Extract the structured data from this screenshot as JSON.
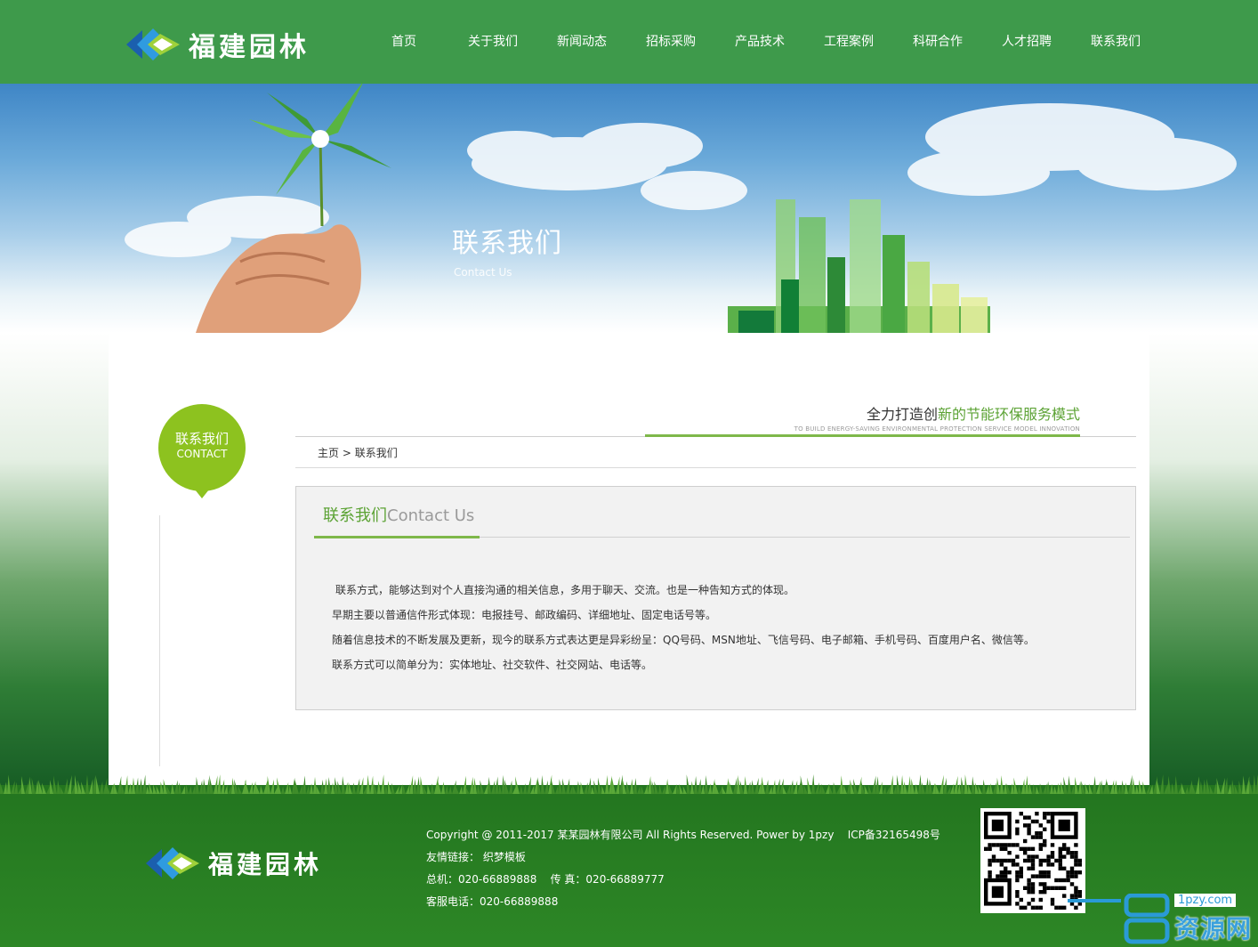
{
  "brand": {
    "name": "福建园林",
    "colors": {
      "header": "#3e9a4b",
      "accent": "#8dc21f",
      "green_text": "#5ca335",
      "footer": "#2d8726"
    }
  },
  "nav": {
    "items": [
      {
        "label": "首页"
      },
      {
        "label": "关于我们"
      },
      {
        "label": "新闻动态"
      },
      {
        "label": "招标采购"
      },
      {
        "label": "产品技术"
      },
      {
        "label": "工程案例"
      },
      {
        "label": "科研合作"
      },
      {
        "label": "人才招聘"
      },
      {
        "label": "联系我们"
      }
    ]
  },
  "banner": {
    "title": "联系我们",
    "subtitle": "Contact Us"
  },
  "sidebar": {
    "title_cn": "联系我们",
    "title_en": "CONTACT"
  },
  "slogan": {
    "prefix": "全力打造创",
    "highlight": "新的节能环保服务模式",
    "english": "TO BUILD ENERGY-SAVING ENVIRONMENTAL PROTECTION SERVICE MODEL INNOVATION"
  },
  "breadcrumb": {
    "home": "主页",
    "separator": ">",
    "current": "联系我们"
  },
  "panel": {
    "title_cn": "联系我们",
    "title_en": "Contact Us",
    "paragraphs": [
      "联系方式，能够达到对个人直接沟通的相关信息，多用于聊天、交流。也是一种告知方式的体现。",
      "早期主要以普通信件形式体现：电报挂号、邮政编码、详细地址、固定电话号等。",
      "随着信息技术的不断发展及更新，现今的联系方式表达更是异彩纷呈：QQ号码、MSN地址、飞信号码、电子邮箱、手机号码、百度用户名、微信等。",
      "联系方式可以简单分为：实体地址、社交软件、社交网站、电话等。"
    ]
  },
  "footer": {
    "copyright": "Copyright @ 2011-2017 某某园林有限公司 All Rights Reserved. Power by 1pzy",
    "icp": "ICP备32165498号",
    "friend_label": "友情链接：",
    "friend_link": "织梦模板",
    "phone_label": "总机：",
    "phone": "020-66889888",
    "fax_label": "传 真：",
    "fax": "020-66889777",
    "service_label": "客服电话：",
    "service": "020-66889888"
  },
  "watermark": {
    "url": "1pzy.com",
    "text": "资源网"
  },
  "icons": [
    "logo-icon",
    "qr-code-icon",
    "pinwheel-icon"
  ]
}
